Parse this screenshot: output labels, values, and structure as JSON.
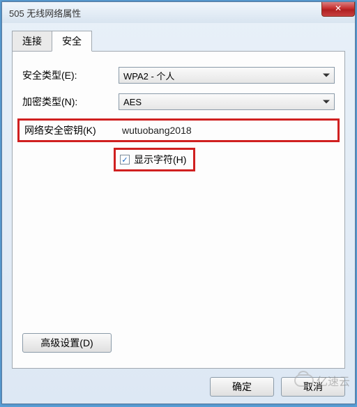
{
  "window": {
    "title": "505 无线网络属性",
    "close_icon": "✕"
  },
  "tabs": {
    "connect": "连接",
    "security": "安全"
  },
  "fields": {
    "security_type_label": "安全类型(E):",
    "security_type_value": "WPA2 - 个人",
    "encryption_label": "加密类型(N):",
    "encryption_value": "AES",
    "key_label": "网络安全密钥(K)",
    "key_value": "wutuobang2018",
    "show_chars_label": "显示字符(H)",
    "show_chars_checked": "✓"
  },
  "buttons": {
    "advanced": "高级设置(D)",
    "ok": "确定",
    "cancel": "取消"
  },
  "watermark": "亿速云"
}
